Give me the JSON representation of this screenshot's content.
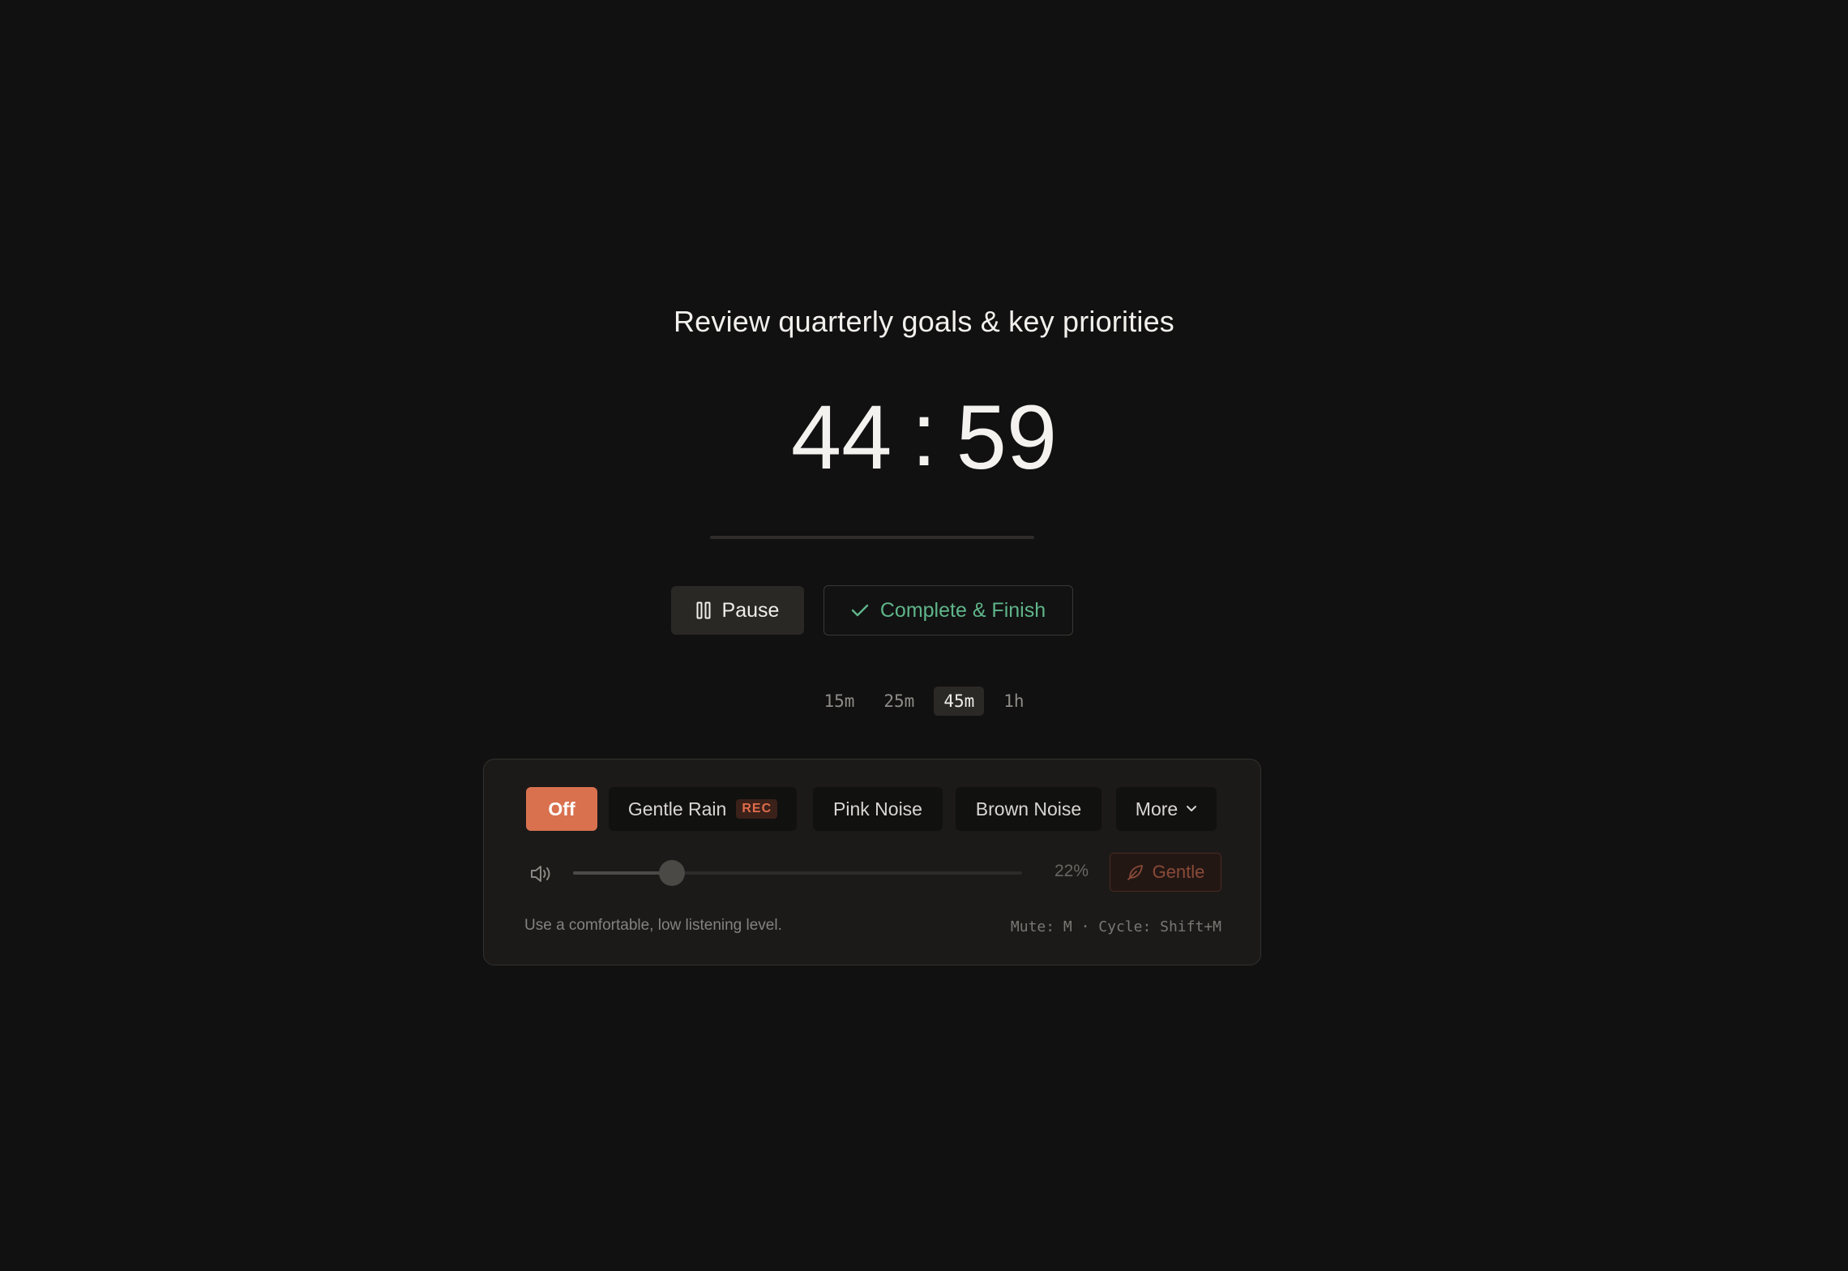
{
  "task": {
    "title": "Review quarterly goals & key priorities"
  },
  "timer": {
    "minutes": "44",
    "separator": ":",
    "seconds": "59",
    "progress": 0.0
  },
  "controls": {
    "pause_label": "Pause",
    "complete_label": "Complete & Finish"
  },
  "durations": [
    {
      "label": "15m",
      "active": false
    },
    {
      "label": "25m",
      "active": false
    },
    {
      "label": "45m",
      "active": true
    },
    {
      "label": "1h",
      "active": false
    }
  ],
  "sound": {
    "options": {
      "off": "Off",
      "rain": "Gentle Rain",
      "rain_badge": "REC",
      "pink": "Pink Noise",
      "brown": "Brown Noise",
      "more": "More"
    },
    "selected": "Off",
    "volume_percent": 22,
    "volume_label": "22%",
    "gentle_label": "Gentle",
    "hint": "Use a comfortable, low listening level.",
    "shortcuts": "Mute: M · Cycle: Shift+M"
  },
  "colors": {
    "background": "#111111",
    "accent": "#d9714f",
    "success": "#5fb58a"
  },
  "icons": {
    "pause": "pause-icon",
    "check": "check-icon",
    "chevron": "chevron-down-icon",
    "volume": "volume-icon",
    "leaf": "leaf-icon"
  }
}
